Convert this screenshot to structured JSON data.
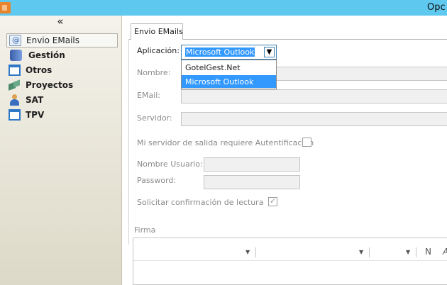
{
  "window": {
    "title": "Opc"
  },
  "sidebar": {
    "collapse_label": "«",
    "items": [
      {
        "label": "Envio EMails",
        "icon": "mail-settings-icon",
        "selected": true
      },
      {
        "label": "Gestión",
        "icon": "book-icon",
        "selected": false
      },
      {
        "label": "Otros",
        "icon": "window-icon",
        "selected": false
      },
      {
        "label": "Proyectos",
        "icon": "cubes-icon",
        "selected": false
      },
      {
        "label": "SAT",
        "icon": "user-icon",
        "selected": false
      },
      {
        "label": "TPV",
        "icon": "window-icon",
        "selected": false
      }
    ]
  },
  "tab": {
    "label": "Envio EMails"
  },
  "form": {
    "aplicacion_label": "Aplicación:",
    "aplicacion_value": "Microsoft Outlook",
    "aplicacion_options": [
      "GotelGest.Net",
      "Microsoft Outlook"
    ],
    "nombre_label": "Nombre:",
    "nombre_value": "",
    "email_label": "EMail:",
    "email_value": "",
    "servidor_label": "Servidor:",
    "servidor_value": "",
    "auth_label": "Mi servidor de salida requiere Autentificación",
    "auth_checked": false,
    "usuario_label": "Nombre Usuario:",
    "usuario_value": "",
    "password_label": "Password:",
    "password_value": "",
    "lectura_label": "Solicitar confirmación de lectura",
    "lectura_checked": true,
    "firma_label": "Firma"
  },
  "editor_toolbar": {
    "bold_label": "N",
    "italic_label": "A"
  },
  "colors": {
    "titlebar": "#5fc8ee",
    "selection": "#3399ff",
    "sidebar_top": "#f4f2ea",
    "sidebar_bottom": "#ddd9c8"
  }
}
